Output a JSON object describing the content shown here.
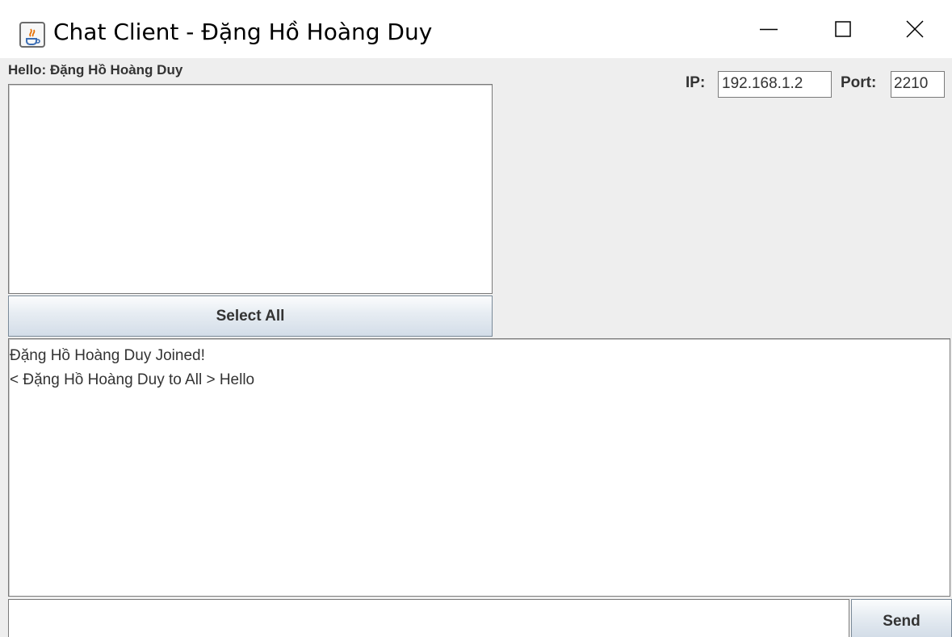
{
  "window": {
    "title": "Chat Client - Đặng Hồ Hoàng Duy",
    "icon": "java-cup-icon"
  },
  "greeting": "Hello: Đặng Hồ Hoàng Duy",
  "user_list": {
    "items": []
  },
  "select_all_label": "Select All",
  "connection": {
    "ip_label": "IP:",
    "ip_value": "192.168.1.2",
    "port_label": "Port:",
    "port_value": "2210"
  },
  "chat": {
    "lines": [
      "Đặng Hồ Hoàng Duy Joined!",
      "< Đặng Hồ Hoàng Duy to All > Hello"
    ]
  },
  "message_input": {
    "value": ""
  },
  "send_label": "Send"
}
